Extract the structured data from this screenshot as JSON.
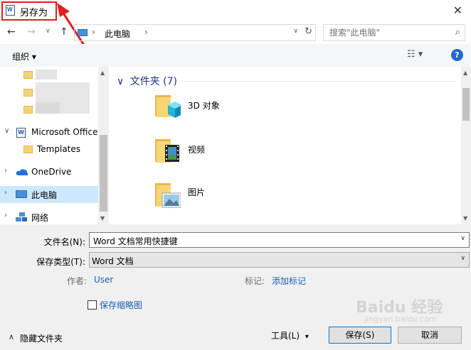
{
  "window": {
    "title": "另存为",
    "close_glyph": "✕"
  },
  "nav": {
    "back_glyph": "←",
    "forward_glyph": "→",
    "recent_glyph": "∨",
    "up_glyph": "↑",
    "address": {
      "sep": "›",
      "location": "此电脑",
      "drop_glyph": "∨",
      "refresh_glyph": "↻"
    },
    "search_placeholder": "搜索\"此电脑\"",
    "search_glyph": "⌕"
  },
  "toolbar": {
    "organize": "组织 ▾",
    "view_glyph": "☷ ▾",
    "help": "?"
  },
  "nav_pane": {
    "items": [
      {
        "label": "Microsoft Office",
        "expand": "∨",
        "icon": "word-doc-icon"
      },
      {
        "label": "Templates",
        "expand": "",
        "icon": "folder-icon"
      },
      {
        "label": "OneDrive",
        "expand": "›",
        "icon": "cloud-icon"
      },
      {
        "label": "此电脑",
        "expand": "›",
        "icon": "computer-icon",
        "selected": true
      },
      {
        "label": "网络",
        "expand": "›",
        "icon": "network-icon"
      }
    ]
  },
  "main": {
    "group": {
      "label": "文件夹 (7)",
      "toggle": "∨"
    },
    "items": [
      {
        "label": "3D 对象",
        "icon": "3d-objects-folder-icon"
      },
      {
        "label": "视频",
        "icon": "videos-folder-icon"
      },
      {
        "label": "图片",
        "icon": "pictures-folder-icon"
      }
    ]
  },
  "form": {
    "filename_label": "文件名(N):",
    "filename_value": "Word 文档常用快捷键",
    "type_label": "保存类型(T):",
    "type_value": "Word 文档",
    "author_label": "作者:",
    "author_value": "User",
    "tags_label": "标记:",
    "tags_value": "添加标记",
    "thumbnail_label": "保存缩略图",
    "thumbnail_checked": false
  },
  "footer": {
    "hide_folders": "隐藏文件夹",
    "hide_glyph": "∧",
    "tools": "工具(L)",
    "tools_glyph": "▾",
    "save": "保存(S)",
    "cancel": "取消"
  },
  "watermark": {
    "main": "Baidu 经验",
    "sub": "jingyan.baidu.com"
  },
  "colors": {
    "accent": "#0078d7",
    "selection": "#cce8ff",
    "link": "#1a5fb4",
    "annotation": "#e02020",
    "group_header": "#1e3287"
  }
}
